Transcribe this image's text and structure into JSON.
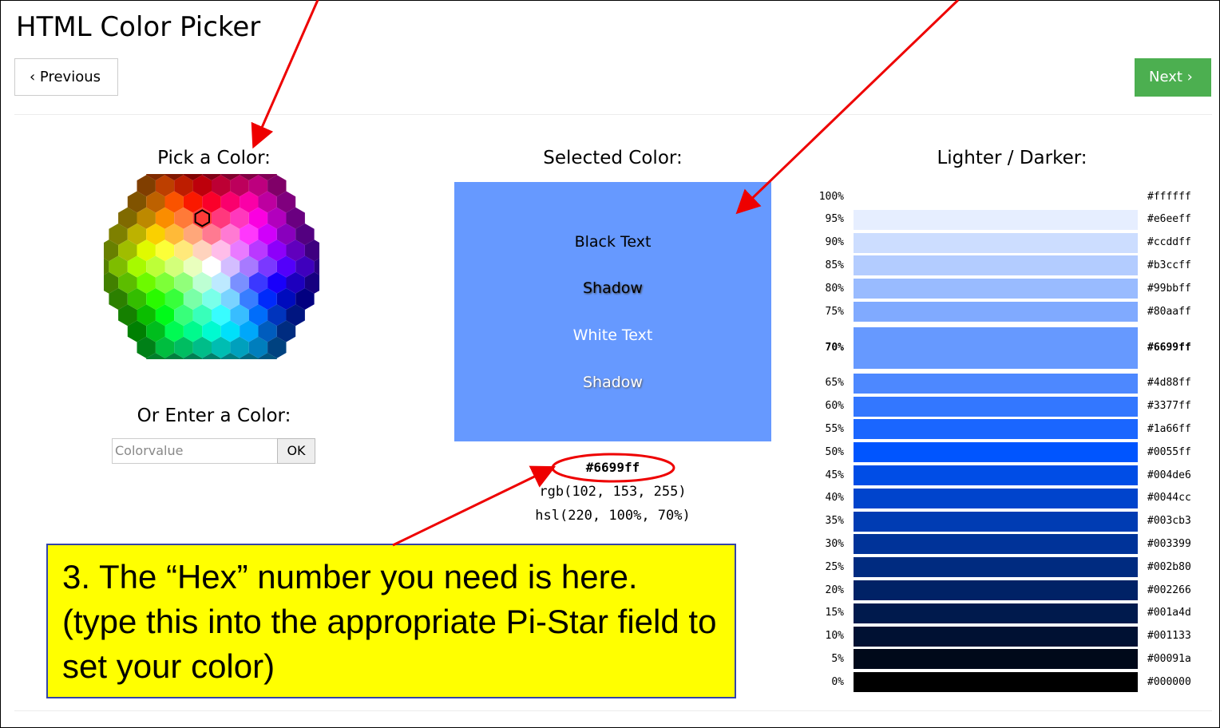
{
  "page": {
    "title": "HTML Color Picker"
  },
  "nav": {
    "previous_label": "‹ Previous",
    "next_label": "Next ›",
    "next_color": "#4CAF50"
  },
  "picker": {
    "heading": "Pick a Color:",
    "enter_heading": "Or Enter a Color:",
    "input_placeholder": "Colorvalue",
    "ok_label": "OK"
  },
  "selected": {
    "heading": "Selected Color:",
    "color": "#6699ff",
    "samples": [
      "Black Text",
      "Shadow",
      "White Text",
      "Shadow"
    ],
    "hex": "#6699ff",
    "rgb": "rgb(102, 153, 255)",
    "hsl": "hsl(220, 100%, 70%)"
  },
  "shades": {
    "heading": "Lighter / Darker:",
    "items": [
      {
        "pct": "100%",
        "hex": "#ffffff"
      },
      {
        "pct": "95%",
        "hex": "#e6eeff"
      },
      {
        "pct": "90%",
        "hex": "#ccddff"
      },
      {
        "pct": "85%",
        "hex": "#b3ccff"
      },
      {
        "pct": "80%",
        "hex": "#99bbff"
      },
      {
        "pct": "75%",
        "hex": "#80aaff"
      },
      {
        "pct": "70%",
        "hex": "#6699ff",
        "current": true
      },
      {
        "pct": "65%",
        "hex": "#4d88ff"
      },
      {
        "pct": "60%",
        "hex": "#3377ff"
      },
      {
        "pct": "55%",
        "hex": "#1a66ff"
      },
      {
        "pct": "50%",
        "hex": "#0055ff"
      },
      {
        "pct": "45%",
        "hex": "#004de6"
      },
      {
        "pct": "40%",
        "hex": "#0044cc"
      },
      {
        "pct": "35%",
        "hex": "#003cb3"
      },
      {
        "pct": "30%",
        "hex": "#003399"
      },
      {
        "pct": "25%",
        "hex": "#002b80"
      },
      {
        "pct": "20%",
        "hex": "#002266"
      },
      {
        "pct": "15%",
        "hex": "#001a4d"
      },
      {
        "pct": "10%",
        "hex": "#001133"
      },
      {
        "pct": "5%",
        "hex": "#00091a"
      },
      {
        "pct": "0%",
        "hex": "#000000"
      }
    ]
  },
  "callout": {
    "text": "3. The “Hex” number you need  is here. (type this into the appropriate Pi-Star field to set your color)"
  },
  "annotation_color": "#ee0000"
}
